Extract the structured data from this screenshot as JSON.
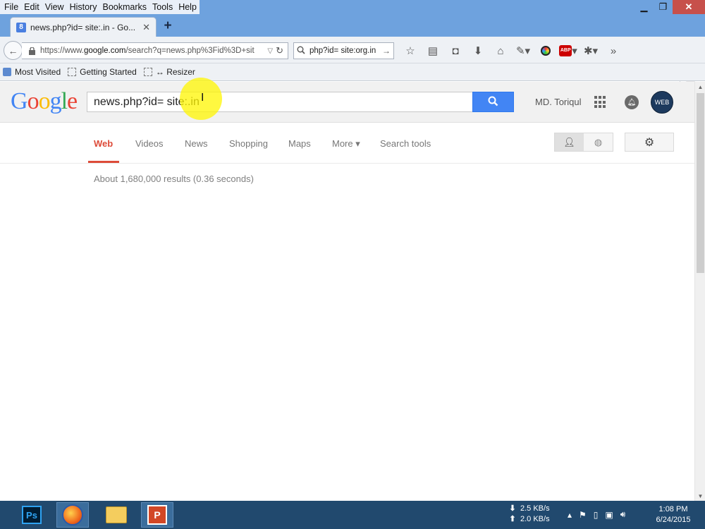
{
  "menu": [
    "File",
    "Edit",
    "View",
    "History",
    "Bookmarks",
    "Tools",
    "Help"
  ],
  "tab": {
    "title": "news.php?id= site:.in - Go...",
    "favicon": "8"
  },
  "url": {
    "prefix": "https://www.",
    "domain": "google.com",
    "rest": "/search?q=news.php%3Fid%3D+sit"
  },
  "search_bar": {
    "value": "php?id= site:org.in"
  },
  "bookmarks": [
    {
      "label": "Most Visited"
    },
    {
      "label": "Getting Started"
    },
    {
      "label": "↔ Resizer"
    }
  ],
  "google": {
    "logo": [
      "G",
      "o",
      "o",
      "g",
      "l",
      "e"
    ],
    "logo_colors": [
      "#4285f4",
      "#ea4335",
      "#fbbc05",
      "#4285f4",
      "#34a853",
      "#ea4335"
    ],
    "query": "news.php?id= site:.in",
    "user_name": "MD. Toriqul",
    "avatar_text": "WEB",
    "nav": [
      {
        "label": "Web"
      },
      {
        "label": "Videos"
      },
      {
        "label": "News"
      },
      {
        "label": "Shopping"
      },
      {
        "label": "Maps"
      },
      {
        "label": "More ▾"
      },
      {
        "label": "Search tools"
      }
    ],
    "result_stats": "About 1,680,000 results (0.36 seconds)"
  },
  "taskbar": {
    "ps_label": "Ps",
    "ppt_label": "P",
    "net_down": "2.5 KB/s",
    "net_up": "2.0 KB/s",
    "time": "1:08 PM",
    "date": "6/24/2015"
  }
}
